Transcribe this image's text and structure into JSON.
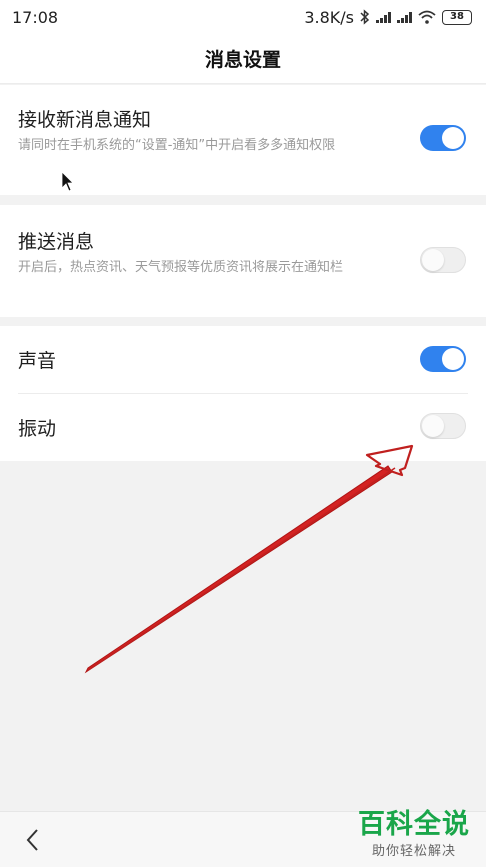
{
  "status_bar": {
    "time": "17:08",
    "speed": "3.8K/s",
    "battery": "38"
  },
  "header": {
    "title": "消息设置"
  },
  "settings": {
    "receive": {
      "title": "接收新消息通知",
      "description": "请同时在手机系统的“设置-通知”中开启看多多通知权限",
      "enabled": true
    },
    "push": {
      "title": "推送消息",
      "description": "开启后，热点资讯、天气预报等优质资讯将展示在通知栏",
      "enabled": false
    },
    "sound": {
      "title": "声音",
      "enabled": true
    },
    "vibrate": {
      "title": "振动",
      "enabled": false
    }
  },
  "watermark": {
    "main": "百科全说",
    "sub": "助你轻松解决"
  },
  "colors": {
    "toggle_on": "#3082ee",
    "annotation_arrow": "#c0201f",
    "watermark": "#1aa64a"
  },
  "icons": {
    "back": "chevron-left-icon",
    "bluetooth": "bluetooth-icon",
    "wifi": "wifi-icon",
    "signal": "signal-icon",
    "cursor": "mouse-cursor-icon"
  }
}
